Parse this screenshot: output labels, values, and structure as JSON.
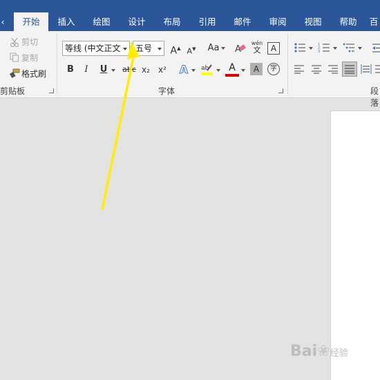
{
  "tabs": [
    {
      "label": "开始",
      "active": true
    },
    {
      "label": "插入"
    },
    {
      "label": "绘图"
    },
    {
      "label": "设计"
    },
    {
      "label": "布局"
    },
    {
      "label": "引用"
    },
    {
      "label": "邮件"
    },
    {
      "label": "审阅"
    },
    {
      "label": "视图"
    },
    {
      "label": "帮助"
    },
    {
      "label": "百"
    }
  ],
  "clipboard": {
    "cut": "剪切",
    "copy": "复制",
    "format_painter": "格式刷",
    "label": "剪贴板"
  },
  "font": {
    "font_name": "等线 (中文正文",
    "font_size": "五号",
    "bold": "B",
    "italic": "I",
    "underline": "U",
    "strike": "abc",
    "subscript": "x₂",
    "superscript": "x²",
    "grow": "A",
    "shrink": "A",
    "case": "Aa",
    "phonetic_top": "wén",
    "phonetic_bottom": "文",
    "border_char": "A",
    "text_effect": "A",
    "font_color": "A",
    "char_shading": "A",
    "enclose": "字",
    "label": "字体"
  },
  "paragraph": {
    "label": "段落"
  },
  "colors": {
    "brand": "#2b579a",
    "highlight": "#ffff00",
    "font_color": "#e00000",
    "annotation_arrow": "#ffee00"
  },
  "watermark": {
    "text": "Bai",
    "suffix": "经验"
  }
}
